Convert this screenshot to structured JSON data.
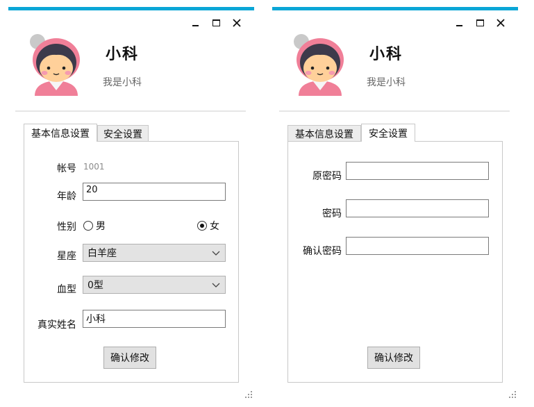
{
  "windows": [
    {
      "profile": {
        "nickname": "小科",
        "signature": "我是小科"
      },
      "tabs": [
        "基本信息设置",
        "安全设置"
      ],
      "basic_info": {
        "account_label": "帐号",
        "account_value": "1001",
        "age_label": "年龄",
        "age_value": "20",
        "gender_label": "性别",
        "gender_options": [
          "男",
          "女"
        ],
        "gender_selected": "女",
        "zodiac_label": "星座",
        "zodiac_value": "白羊座",
        "blood_label": "血型",
        "blood_value": "0型",
        "realname_label": "真实姓名",
        "realname_value": "小科",
        "confirm_button": "确认修改"
      }
    },
    {
      "profile": {
        "nickname": "小科",
        "signature": "我是小科"
      },
      "tabs": [
        "基本信息设置",
        "安全设置"
      ],
      "security": {
        "old_password_label": "原密码",
        "password_label": "密码",
        "confirm_password_label": "确认密码",
        "old_password_value": "",
        "password_value": "",
        "confirm_password_value": "",
        "confirm_button": "确认修改"
      }
    }
  ],
  "icons": {
    "minimize": "minimize-icon",
    "maximize": "maximize-icon",
    "close": "close-icon",
    "dropdown": "chevron-down-icon",
    "resize": "resize-grip-icon"
  },
  "colors": {
    "accent": "#0aa6d6",
    "avatar_pink": "#f07f98",
    "avatar_hair": "#3d3a4b",
    "avatar_skin": "#ffd09a"
  }
}
